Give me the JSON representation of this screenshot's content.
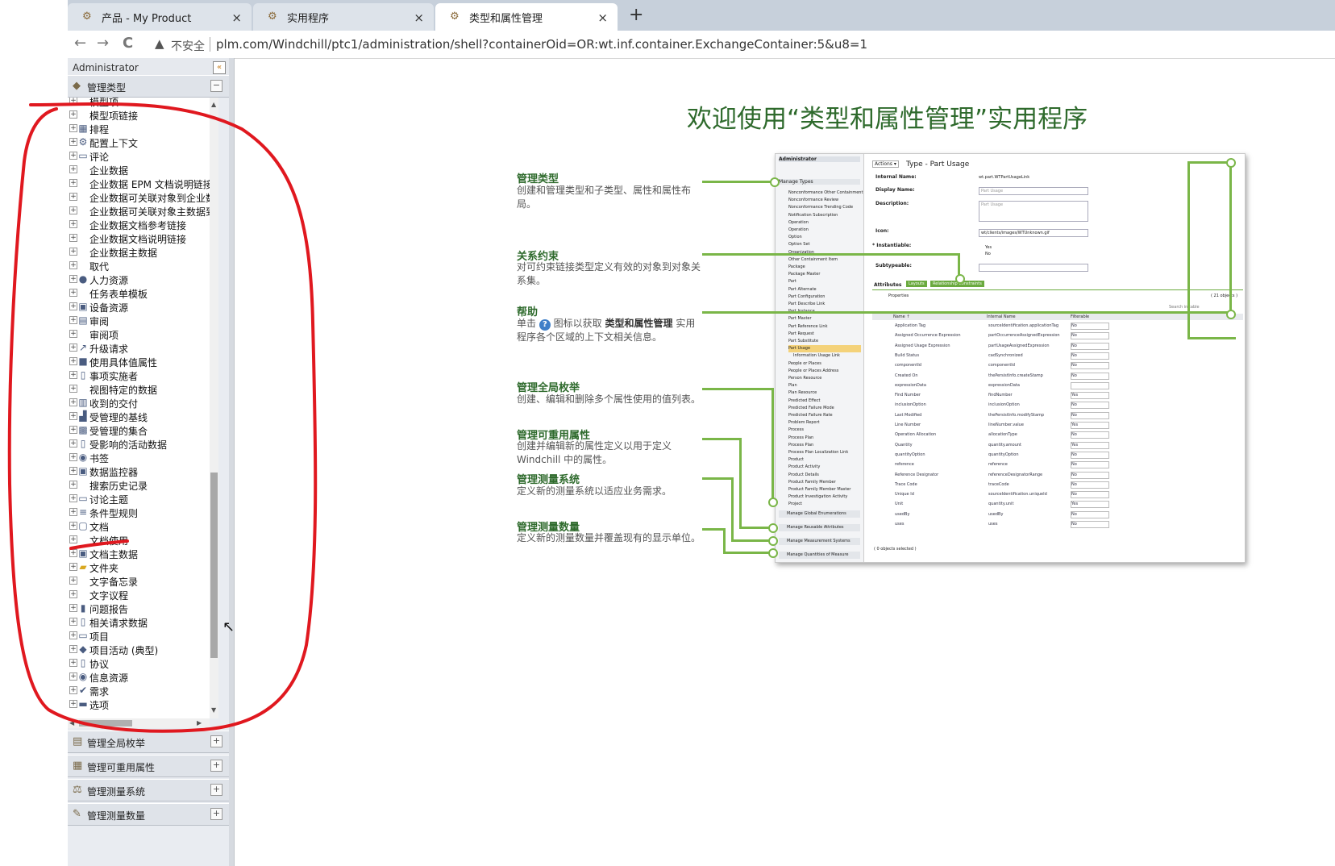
{
  "browser": {
    "tabs": [
      {
        "title": "产品 - My Product",
        "close": "×"
      },
      {
        "title": "实用程序",
        "close": "×"
      },
      {
        "title": "类型和属性管理",
        "close": "×"
      }
    ],
    "new_tab": "+",
    "back": "←",
    "forward": "→",
    "reload": "C",
    "insecure_label": "不安全",
    "url": "plm.com/Windchill/ptc1/administration/shell?containerOid=OR:wt.inf.container.ExchangeContainer:5&u8=1"
  },
  "left_panel": {
    "title": "Administrator",
    "collapse_icon": "«",
    "manage_types": "管理类型",
    "tree_items": [
      {
        "label": "模型项",
        "icon": ""
      },
      {
        "label": "模型项链接",
        "icon": ""
      },
      {
        "label": "排程",
        "icon": "grid-icon"
      },
      {
        "label": "配置上下文",
        "icon": "config-icon"
      },
      {
        "label": "评论",
        "icon": "comment-icon"
      },
      {
        "label": "企业数据",
        "icon": ""
      },
      {
        "label": "企业数据 EPM 文档说明链接",
        "icon": ""
      },
      {
        "label": "企业数据可关联对象到企业数",
        "icon": ""
      },
      {
        "label": "企业数据可关联对象主数据到",
        "icon": ""
      },
      {
        "label": "企业数据文档参考链接",
        "icon": ""
      },
      {
        "label": "企业数据文档说明链接",
        "icon": ""
      },
      {
        "label": "企业数据主数据",
        "icon": ""
      },
      {
        "label": "取代",
        "icon": ""
      },
      {
        "label": "人力资源",
        "icon": "people-icon"
      },
      {
        "label": "任务表单模板",
        "icon": ""
      },
      {
        "label": "设备资源",
        "icon": "equipment-icon"
      },
      {
        "label": "审阅",
        "icon": "review-icon"
      },
      {
        "label": "审阅项",
        "icon": ""
      },
      {
        "label": "升级请求",
        "icon": "promotion-icon"
      },
      {
        "label": "使用具体值属性",
        "icon": "block-icon"
      },
      {
        "label": "事项实施者",
        "icon": "doc-icon"
      },
      {
        "label": "视图特定的数据",
        "icon": ""
      },
      {
        "label": "收到的交付",
        "icon": "delivery-icon"
      },
      {
        "label": "受管理的基线",
        "icon": "baseline-icon"
      },
      {
        "label": "受管理的集合",
        "icon": "collection-icon"
      },
      {
        "label": "受影响的活动数据",
        "icon": "doc-icon"
      },
      {
        "label": "书签",
        "icon": "bookmark-icon"
      },
      {
        "label": "数据监控器",
        "icon": "monitor-icon"
      },
      {
        "label": "搜索历史记录",
        "icon": ""
      },
      {
        "label": "讨论主题",
        "icon": "discussion-icon"
      },
      {
        "label": "条件型规则",
        "icon": "rule-icon"
      },
      {
        "label": "文档",
        "icon": "document-icon"
      },
      {
        "label": "文档使用",
        "icon": ""
      },
      {
        "label": "文档主数据",
        "icon": "doc-master-icon"
      },
      {
        "label": "文件夹",
        "icon": "folder-icon"
      },
      {
        "label": "文字备忘录",
        "icon": ""
      },
      {
        "label": "文字议程",
        "icon": ""
      },
      {
        "label": "问题报告",
        "icon": "problem-icon"
      },
      {
        "label": "相关请求数据",
        "icon": "doc-icon"
      },
      {
        "label": "项目",
        "icon": "project-icon"
      },
      {
        "label": "项目活动 (典型)",
        "icon": "activity-icon"
      },
      {
        "label": "协议",
        "icon": "agreement-icon"
      },
      {
        "label": "信息资源",
        "icon": "info-icon"
      },
      {
        "label": "需求",
        "icon": "check-icon"
      },
      {
        "label": "选项",
        "icon": "option-icon"
      }
    ],
    "accordion": [
      {
        "label": "管理全局枚举",
        "toggle": "+"
      },
      {
        "label": "管理可重用属性",
        "toggle": "+"
      },
      {
        "label": "管理测量系统",
        "toggle": "+"
      },
      {
        "label": "管理测量数量",
        "toggle": "+"
      }
    ]
  },
  "main": {
    "title": "欢迎使用“类型和属性管理”实用程序",
    "sections": [
      {
        "title": "管理类型",
        "desc": "创建和管理类型和子类型、属性和属性布局。"
      },
      {
        "title": "关系约束",
        "desc": "对可约束链接类型定义有效的对象到对象关系集。"
      },
      {
        "title": "帮助",
        "desc_pre": "单击",
        "desc_mid": "图标以获取",
        "desc_bold": "类型和属性管理",
        "desc_post": "实用程序各个区域的上下文相关信息。"
      },
      {
        "title": "管理全局枚举",
        "desc": "创建、编辑和删除多个属性使用的值列表。"
      },
      {
        "title": "管理可重用属性",
        "desc": "创建并编辑新的属性定义以用于定义 Windchill 中的属性。"
      },
      {
        "title": "管理测量系统",
        "desc": "定义新的测量系统以适应业务需求。"
      },
      {
        "title": "管理测量数量",
        "desc": "定义新的测量数量并覆盖现有的显示单位。"
      }
    ]
  },
  "preview": {
    "admin": "Administrator",
    "manage_types": "Manage Types",
    "tree": [
      "Nonconformance Other Containment",
      "Nonconformance Review",
      "Nonconformance Trending Code",
      "Notification Subscription",
      "Operation",
      "Operation",
      "Option",
      "Option Set",
      "Organization",
      "Other Containment Item",
      "Package",
      "Package Master",
      "Part",
      "Part Alternate",
      "Part Configuration",
      "Part Describe Link",
      "Part Instance",
      "Part Master",
      "Part Reference Link",
      "Part Request",
      "Part Substitute",
      "Part Usage",
      "Information Usage Link",
      "People or Places",
      "People or Places Address",
      "Person Resource",
      "Plan",
      "Plan Resource",
      "Predicted Effect",
      "Predicted Failure Mode",
      "Predicted Failure Rate",
      "Problem Report",
      "Process",
      "Process Plan",
      "Process Plan",
      "Process Plan Localization Link",
      "Product",
      "Product Activity",
      "Product Details",
      "Product Family Member",
      "Product Family Member Master",
      "Product Investigation Activity",
      "Project"
    ],
    "bottom": [
      "Manage Global Enumerations",
      "Manage Reusable Attributes",
      "Manage Measurement Systems",
      "Manage Quantities of Measure"
    ],
    "actions": "Actions ▾",
    "type_label": "Type - Part Usage",
    "internal_name_label": "Internal Name:",
    "internal_name": "wt.part.WTPartUsageLink",
    "display_name_label": "Display Name:",
    "display_name": "Part Usage",
    "description_label": "Description:",
    "description": "Part Usage",
    "icon_label": "Icon:",
    "icon_value": "wt/clients/images/WTUnknown.gif",
    "instantiable_label": "* Instantiable:",
    "yes": "Yes",
    "no": "No",
    "subtypeable_label": "Subtypeable:",
    "tabs": [
      "Attributes",
      "Layouts",
      "Relationship Constraints"
    ],
    "properties": "Properties",
    "count": "( 21 objects )",
    "search": "Search in table",
    "col_name": "Name ↑",
    "col_internal": "Internal Name",
    "col_filterable": "Filterable",
    "rows": [
      [
        "Application Tag",
        "sourceIdentification.applicationTag",
        "No"
      ],
      [
        "Assigned Occurrence Expression",
        "partOccurrenceAssignedExpression",
        "No"
      ],
      [
        "Assigned Usage Expression",
        "partUsageAssignedExpression",
        "No"
      ],
      [
        "Build Status",
        "cadSynchronized",
        "No"
      ],
      [
        "componentId",
        "componentId",
        "No"
      ],
      [
        "Created On",
        "thePersistInfo.createStamp",
        "No"
      ],
      [
        "expressionData",
        "expressionData",
        ""
      ],
      [
        "Find Number",
        "findNumber",
        "Yes"
      ],
      [
        "inclusionOption",
        "inclusionOption",
        "No"
      ],
      [
        "Last Modified",
        "thePersistInfo.modifyStamp",
        "No"
      ],
      [
        "Line Number",
        "lineNumber.value",
        "Yes"
      ],
      [
        "Operation Allocation",
        "allocationType",
        "No"
      ],
      [
        "Quantity",
        "quantity.amount",
        "Yes"
      ],
      [
        "quantityOption",
        "quantityOption",
        "No"
      ],
      [
        "reference",
        "reference",
        "No"
      ],
      [
        "Reference Designator",
        "referenceDesignatorRange",
        "No"
      ],
      [
        "Trace Code",
        "traceCode",
        "No"
      ],
      [
        "Unique Id",
        "sourceIdentification.uniqueId",
        "No"
      ],
      [
        "Unit",
        "quantity.unit",
        "Yes"
      ],
      [
        "usedBy",
        "usedBy",
        "No"
      ],
      [
        "uses",
        "uses",
        "No"
      ]
    ],
    "selected": "( 0 objects selected )"
  }
}
